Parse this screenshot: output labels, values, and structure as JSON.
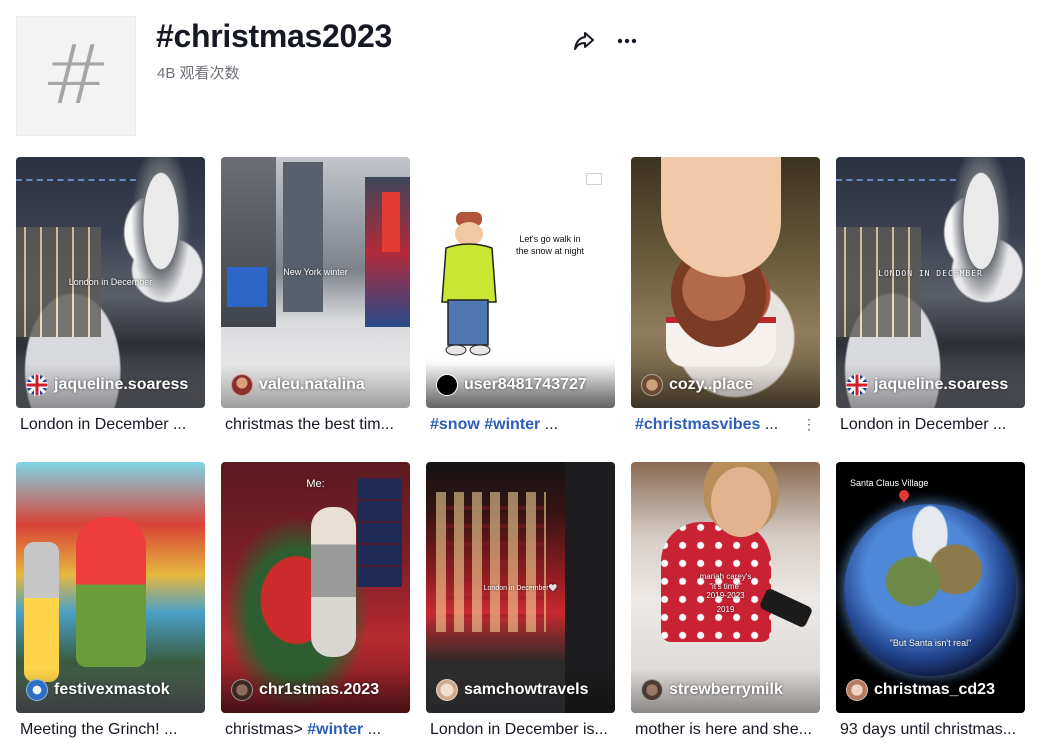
{
  "header": {
    "avatar_glyph": "#",
    "title": "#christmas2023",
    "views": "4B 观看次数",
    "share_icon": "share-arrow-icon",
    "more_icon": "more-dots-icon"
  },
  "colors": {
    "text": "#161823",
    "secondary_text": "#6f7178",
    "hashtag": "#2b5db9"
  },
  "videos": [
    {
      "author": "jaqueline.soaress",
      "avatar": "uk-flag",
      "overlay": "London in December",
      "caption": "London in December ..."
    },
    {
      "author": "valeu.natalina",
      "avatar": "user-photo",
      "overlay": "New York winter",
      "caption": "christmas the best tim..."
    },
    {
      "author": "user8481743727",
      "avatar": "black-circle",
      "overlay": "Let's go walk in\nthe snow at night",
      "caption_parts": [
        "#snow",
        "#winter",
        "..."
      ]
    },
    {
      "author": "cozy..place",
      "avatar": "user-photo",
      "overlay": "",
      "caption_parts": [
        "#christmasvibes",
        "..."
      ]
    },
    {
      "author": "jaqueline.soaress",
      "avatar": "uk-flag",
      "overlay": "LONDON IN DECEMBER",
      "caption": "London in December ..."
    },
    {
      "author": "festivexmastok",
      "avatar": "user-photo",
      "overlay": "",
      "caption": "Meeting the Grinch! ..."
    },
    {
      "author": "chr1stmas.2023",
      "avatar": "user-photo",
      "overlay": "Me:",
      "caption_text": "christmas>",
      "caption_tag": "#winter",
      "caption_tail": "..."
    },
    {
      "author": "samchowtravels",
      "avatar": "user-photo",
      "overlay": "London in December🤍",
      "caption": "London in December is..."
    },
    {
      "author": "strewberrymilk",
      "avatar": "user-photo",
      "overlay": "mariah carey's\n\"it's time\"\n2019-2023",
      "overlay_year": "2019",
      "caption": "mother is here and she..."
    },
    {
      "author": "christmas_cd23",
      "avatar": "user-photo",
      "overlay": "Santa Claus Village",
      "overlay_bottom": "\"But Santa isn't real\"",
      "caption": "93 days until christmas..."
    }
  ]
}
